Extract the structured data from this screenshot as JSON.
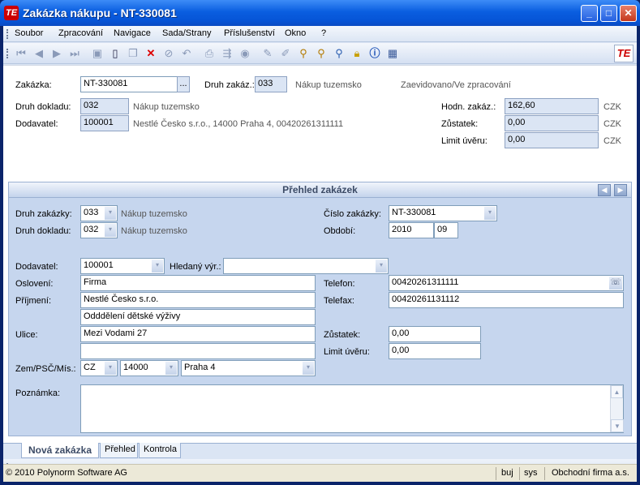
{
  "window": {
    "title": "Zakázka nákupu - NT-330081",
    "icon": "app-logo-icon"
  },
  "menu": [
    "Soubor",
    "Zpracování",
    "Navigace",
    "Sada/Strany",
    "Příslušenství",
    "Okno",
    "?"
  ],
  "toolbar": {
    "icons": [
      "first-icon",
      "prev-icon",
      "next-icon",
      "last-icon",
      "save-icon",
      "new-icon",
      "copy-icon",
      "delete-icon",
      "cancel-icon",
      "undo-icon",
      "print-icon",
      "export-icon",
      "refresh-icon",
      "edit-icon",
      "highlight-icon",
      "filter-icon",
      "search-icon",
      "find-user-icon",
      "lock-icon",
      "info-icon",
      "calendar-icon"
    ],
    "logo_label": "TE"
  },
  "header": {
    "zakazka_label": "Zakázka:",
    "zakazka_value": "NT-330081",
    "lookup_label": "...",
    "druh_zak_label": "Druh zakáz.:",
    "druh_zak_value": "033",
    "druh_zak_desc": "Nákup tuzemsko",
    "status": "Zaevidovano/Ve zpracování",
    "druh_dokladu_label": "Druh dokladu:",
    "druh_dokladu_value": "032",
    "druh_dokladu_desc": "Nákup tuzemsko",
    "dodavatel_label": "Dodavatel:",
    "dodavatel_value": "100001",
    "dodavatel_desc": "Nestlé Česko s.r.o., 14000 Praha 4, 00420261311111",
    "hodn_label": "Hodn. zakáz.:",
    "hodn_value": "162,60",
    "hodn_cur": "CZK",
    "zustatek_label": "Zůstatek:",
    "zustatek_value": "0,00",
    "zustatek_cur": "CZK",
    "limit_label": "Limit úvěru:",
    "limit_value": "0,00",
    "limit_cur": "CZK"
  },
  "panel": {
    "title": "Přehled zakázek",
    "druh_zakazky_label": "Druh zakázky:",
    "druh_zakazky_value": "033",
    "druh_zakazky_desc": "Nákup tuzemsko",
    "druh_dokladu_label": "Druh dokladu:",
    "druh_dokladu_value": "032",
    "druh_dokladu_desc": "Nákup tuzemsko",
    "cislo_label": "Číslo zakázky:",
    "cislo_value": "NT-330081",
    "obdobi_label": "Období:",
    "obdobi_year": "2010",
    "obdobi_month": "09",
    "dodavatel_label": "Dodavatel:",
    "dodavatel_value": "100001",
    "hledany_label": "Hledaný výr.:",
    "hledany_value": "",
    "osloveni_label": "Oslovení:",
    "osloveni_value": "Firma",
    "prijmeni_label": "Příjmení:",
    "prijmeni_value": "Nestlé Česko s.r.o.",
    "prijmeni_value2": "Odddělení dětské výživy",
    "ulice_label": "Ulice:",
    "ulice_value": "Mezi Vodami 27",
    "ulice_value2": "",
    "zem_label": "Zem/PSČ/Mís.:",
    "zem_value": "CZ",
    "psc_value": "14000",
    "misto_value": "Praha 4",
    "telefon_label": "Telefon:",
    "telefon_value": "00420261311111",
    "telefax_label": "Telefax:",
    "telefax_value": "00420261131112",
    "zustatek_label": "Zůstatek:",
    "zustatek_value": "0,00",
    "limit_label": "Limit úvěru:",
    "limit_value": "0,00",
    "poznamka_label": "Poznámka:",
    "poznamka_value": ""
  },
  "tabs": [
    "Nová zakázka",
    "Přehled",
    "Kontrola"
  ],
  "statusbar": {
    "copyright": "© 2010 Polynorm Software AG",
    "user1": "buj",
    "user2": "sys",
    "company": "Obchodní firma a.s."
  }
}
